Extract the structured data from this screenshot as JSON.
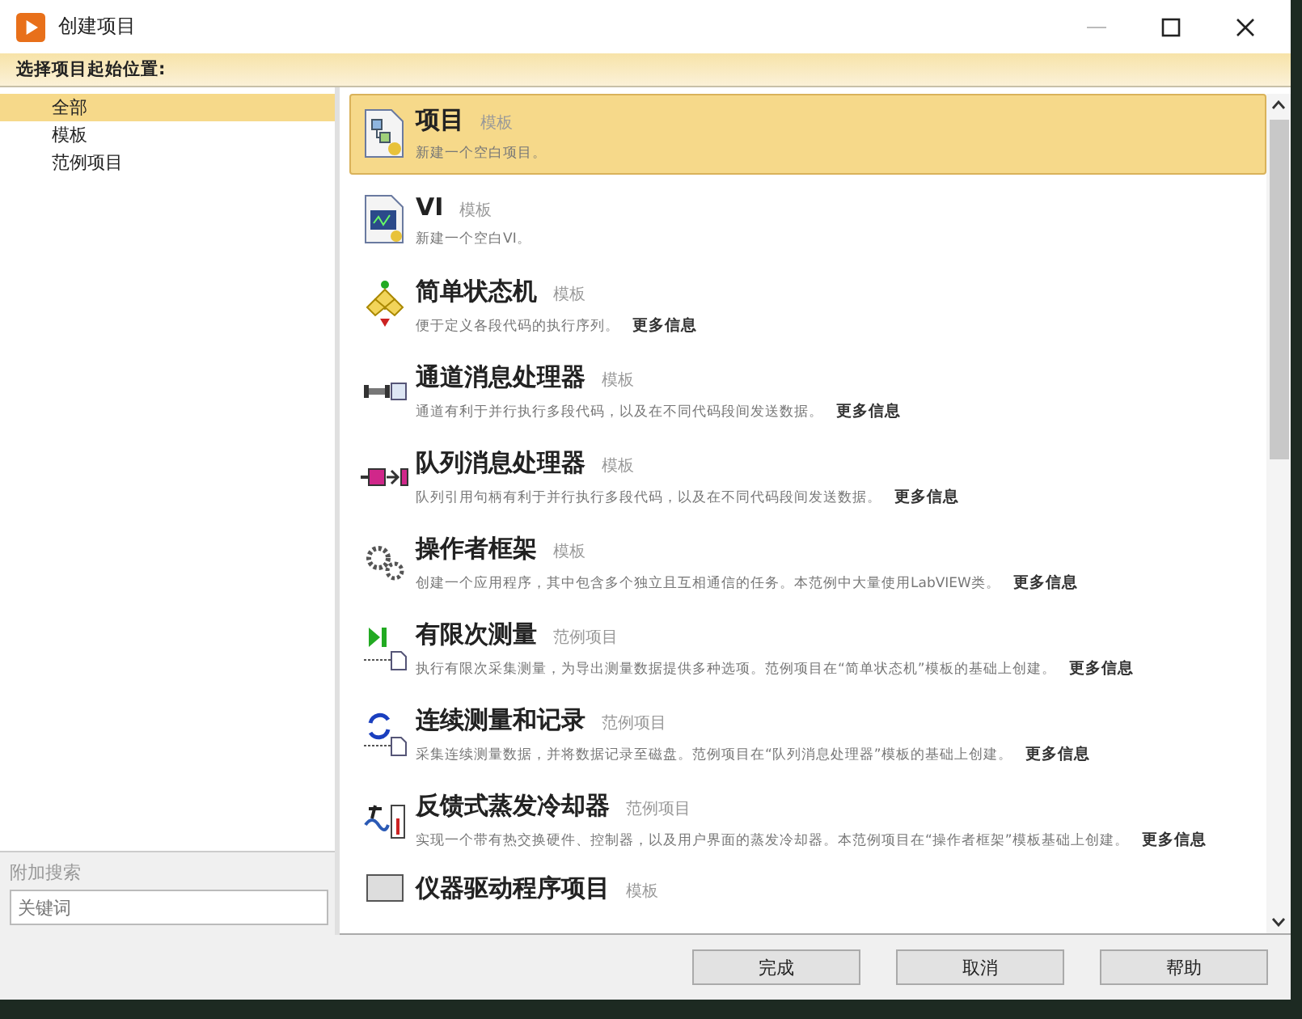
{
  "window": {
    "title": "创建项目"
  },
  "header": {
    "label": "选择项目起始位置:"
  },
  "sidebar": {
    "items": [
      {
        "label": "全部",
        "selected": true
      },
      {
        "label": "模板",
        "selected": false
      },
      {
        "label": "范例项目",
        "selected": false
      }
    ],
    "search": {
      "label": "附加搜索",
      "placeholder": "关键词"
    }
  },
  "items": [
    {
      "title": "项目",
      "type": "模板",
      "description": "新建一个空白项目。",
      "selected": true
    },
    {
      "title": "VI",
      "type": "模板",
      "description": "新建一个空白VI。",
      "selected": false
    },
    {
      "title": "简单状态机",
      "type": "模板",
      "description": "便于定义各段代码的执行序列。",
      "more": "更多信息",
      "selected": false
    },
    {
      "title": "通道消息处理器",
      "type": "模板",
      "description": "通道有利于并行执行多段代码，以及在不同代码段间发送数据。",
      "more": "更多信息",
      "selected": false
    },
    {
      "title": "队列消息处理器",
      "type": "模板",
      "description": "队列引用句柄有利于并行执行多段代码，以及在不同代码段间发送数据。",
      "more": "更多信息",
      "selected": false
    },
    {
      "title": "操作者框架",
      "type": "模板",
      "description": "创建一个应用程序，其中包含多个独立且互相通信的任务。本范例中大量使用LabVIEW类。",
      "more": "更多信息",
      "selected": false
    },
    {
      "title": "有限次测量",
      "type": "范例项目",
      "description": "执行有限次采集测量，为导出测量数据提供多种选项。范例项目在“简单状态机”模板的基础上创建。",
      "more": "更多信息",
      "selected": false
    },
    {
      "title": "连续测量和记录",
      "type": "范例项目",
      "description": "采集连续测量数据，并将数据记录至磁盘。范例项目在“队列消息处理器”模板的基础上创建。",
      "more": "更多信息",
      "selected": false
    },
    {
      "title": "反馈式蒸发冷却器",
      "type": "范例项目",
      "description": "实现一个带有热交换硬件、控制器，以及用户界面的蒸发冷却器。本范例项目在“操作者框架”模板基础上创建。",
      "more": "更多信息",
      "selected": false
    },
    {
      "title": "仪器驱动程序项目",
      "type": "模板",
      "selected": false
    }
  ],
  "buttons": [
    "完成",
    "取消",
    "帮助"
  ]
}
